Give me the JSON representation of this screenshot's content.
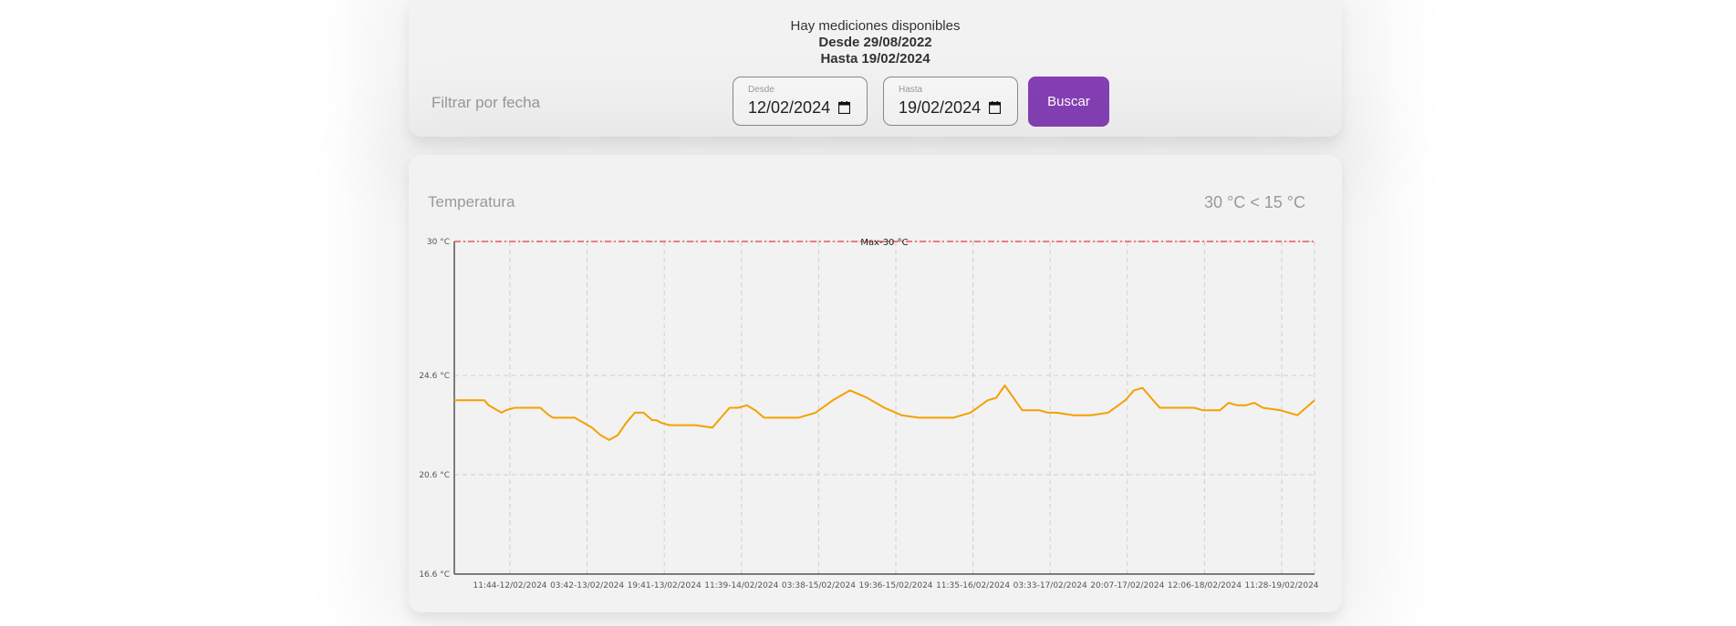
{
  "filter": {
    "available_title": "Hay mediciones disponibles",
    "available_from": "Desde 29/08/2022",
    "available_to": "Hasta 19/02/2024",
    "filter_label": "Filtrar por fecha",
    "from_label": "Desde",
    "from_value": "12/02/2024",
    "to_label": "Hasta",
    "to_value": "19/02/2024",
    "search_button": "Buscar"
  },
  "chart_card": {
    "title": "Temperatura",
    "range_text": "30 °C < 15 °C"
  },
  "chart_data": {
    "type": "line",
    "title": "Temperatura",
    "xlabel": "",
    "ylabel": "",
    "y_ticks": [
      "30 °C",
      "24.6 °C",
      "20.6 °C",
      "16.6 °C"
    ],
    "y_tick_values": [
      30,
      24.6,
      20.6,
      16.6
    ],
    "ylim": [
      16.6,
      30
    ],
    "x_tick_labels": [
      "11:44-12/02/2024",
      "03:42-13/02/2024",
      "19:41-13/02/2024",
      "11:39-14/02/2024",
      "03:38-15/02/2024",
      "19:36-15/02/2024",
      "11:35-16/02/2024",
      "03:33-17/02/2024",
      "20:07-17/02/2024",
      "12:06-18/02/2024",
      "11:28-19/02/2024"
    ],
    "grid": true,
    "threshold": {
      "label": "Max-30 °C",
      "value": 30,
      "color": "#e53935"
    },
    "series": [
      {
        "color": "#f5a000",
        "x": [
          0,
          3.5,
          4,
          5,
          5.5,
          6,
          7,
          8,
          10,
          11,
          11.5,
          12,
          14,
          15,
          16,
          17,
          18,
          19,
          20,
          21,
          22,
          23,
          23.5,
          24,
          25,
          26,
          27,
          28,
          30,
          31,
          32,
          33,
          34,
          35,
          36,
          37,
          38,
          39,
          40,
          41,
          42,
          44,
          46,
          48,
          50,
          52,
          54,
          56,
          58,
          60,
          62,
          63,
          64,
          65,
          66,
          67,
          68,
          69,
          70,
          72,
          74,
          76,
          78,
          79,
          80,
          81,
          82,
          83,
          84,
          85,
          86,
          87,
          88,
          89,
          90,
          91,
          92,
          93,
          94,
          96,
          98,
          100
        ],
        "values": [
          23.6,
          23.6,
          23.4,
          23.2,
          23.1,
          23.2,
          23.3,
          23.3,
          23.3,
          23.0,
          22.9,
          22.9,
          22.9,
          22.7,
          22.5,
          22.2,
          22.0,
          22.2,
          22.7,
          23.1,
          23.1,
          22.8,
          22.8,
          22.7,
          22.6,
          22.6,
          22.6,
          22.6,
          22.5,
          22.9,
          23.3,
          23.3,
          23.4,
          23.2,
          22.9,
          22.9,
          22.9,
          22.9,
          22.9,
          23.0,
          23.1,
          23.6,
          24.0,
          23.7,
          23.3,
          23.0,
          22.9,
          22.9,
          22.9,
          23.1,
          23.6,
          23.7,
          24.2,
          23.7,
          23.2,
          23.2,
          23.2,
          23.1,
          23.1,
          23.0,
          23.0,
          23.1,
          23.6,
          24.0,
          24.1,
          23.7,
          23.3,
          23.3,
          23.3,
          23.3,
          23.3,
          23.2,
          23.2,
          23.2,
          23.5,
          23.4,
          23.4,
          23.5,
          23.3,
          23.2,
          23.0,
          23.6
        ]
      }
    ]
  }
}
